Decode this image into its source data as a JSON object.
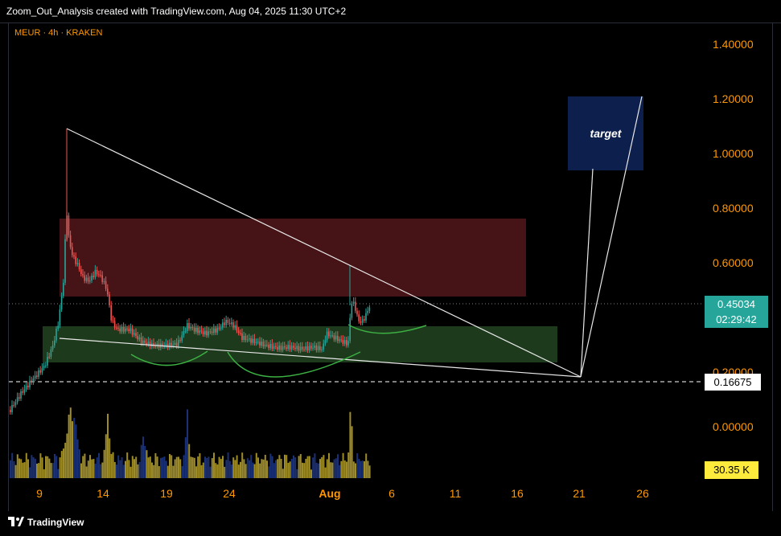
{
  "header": {
    "title": "Zoom_Out_Analysis created with TradingView.com, Aug 04, 2025 11:30 UTC+2"
  },
  "chart": {
    "symbol_line": "MEUR · 4h · KRAKEN",
    "price_labels": [
      "1.40000",
      "1.20000",
      "1.00000",
      "0.80000",
      "0.60000",
      "0.20000",
      "0.00000"
    ],
    "current_price": "0.45034",
    "countdown": "02:29:42",
    "ref_level": "0.16675",
    "volume": "30.35 K",
    "annotation": "target",
    "time_labels": [
      "9",
      "14",
      "19",
      "24",
      "Aug",
      "6",
      "11",
      "16",
      "21",
      "26"
    ],
    "colors": {
      "price_axis": "#ff9800",
      "up": "#26a69a",
      "down": "#ef5350",
      "supply_zone": "#4a1418",
      "demand_zone": "#1e3a1c",
      "target_box": "#0d1f4d",
      "volume_gold": "#b9a52e",
      "volume_blue": "#1e3a8a"
    }
  },
  "footer": {
    "brand": "TradingView"
  }
}
